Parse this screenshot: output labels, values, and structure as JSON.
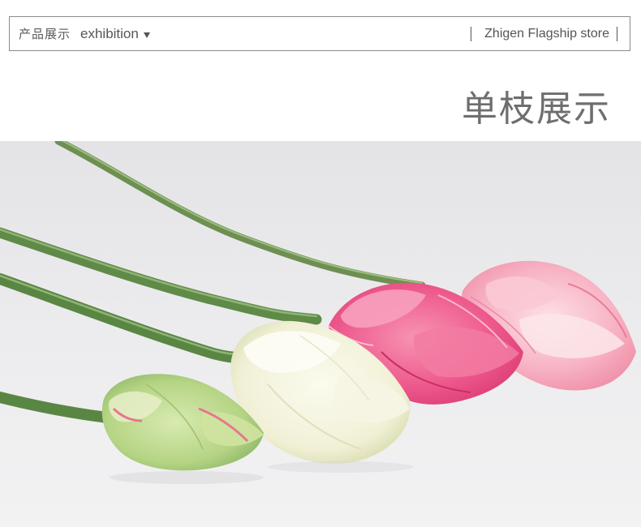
{
  "header": {
    "category_cn": "产品展示",
    "category_en": "exhibition",
    "caret_icon": "caret-down-icon",
    "store_name": "Zhigen Flagship store"
  },
  "section": {
    "title": "单枝展示"
  },
  "photo": {
    "subject": "four lotus flower buds on long green stems",
    "colors": {
      "background": "#e9e9eb",
      "stem": "#5d8a4a",
      "bud_green": "#b9d68a",
      "bud_white": "#f3f2dc",
      "bud_pink": "#ee4f86",
      "bud_light_pink": "#f6a6b9"
    }
  }
}
